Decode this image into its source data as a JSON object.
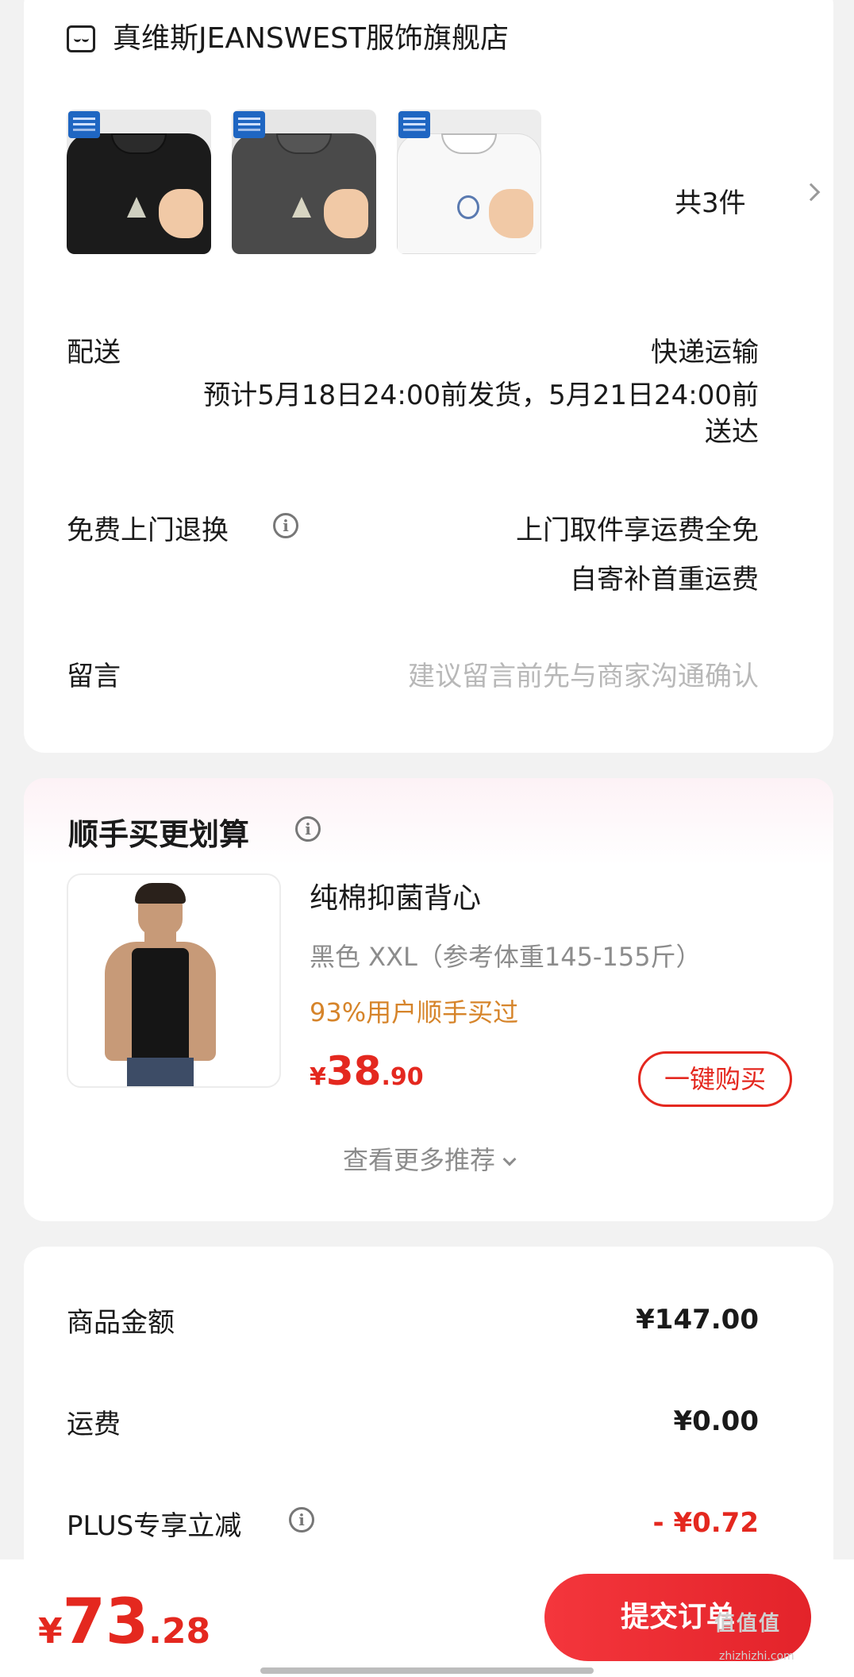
{
  "store": {
    "name": "真维斯JEANSWEST服饰旗舰店",
    "items": [
      {
        "name": "black-tee",
        "color": "#1b1b1b"
      },
      {
        "name": "gray-tee",
        "color": "#4a4a4a"
      },
      {
        "name": "white-tee",
        "color": "#f6f6f6"
      }
    ],
    "count_label": "共3件"
  },
  "delivery": {
    "label": "配送",
    "method": "快递运输",
    "estimate_line1": "预计5月18日24:00前发货，5月21日24:00前",
    "estimate_line2": "送达"
  },
  "returns": {
    "label": "免费上门退换",
    "line1": "上门取件享运费全免",
    "line2": "自寄补首重运费"
  },
  "message": {
    "label": "留言",
    "placeholder": "建议留言前先与商家沟通确认"
  },
  "upsell": {
    "title": "顺手买更划算",
    "product_name": "纯棉抑菌背心",
    "spec": "黑色   XXL（参考体重145-155斤）",
    "social": "93%用户顺手买过",
    "price_currency": "¥",
    "price_int": "38",
    "price_dec": ".90",
    "buy_label": "一键购买",
    "more_label": "查看更多推荐"
  },
  "summary": {
    "rows": [
      {
        "label": "商品金额",
        "value": "¥147.00"
      },
      {
        "label": "运费",
        "value": "¥0.00"
      },
      {
        "label": "PLUS专享立减",
        "value": "- ¥0.72"
      }
    ]
  },
  "footer": {
    "total_currency": "¥",
    "total_int": "73",
    "total_dec": ".28",
    "submit_label": "提交订单",
    "watermark": "值值值",
    "watermark_url": "zhizhizhi.com"
  },
  "colors": {
    "accent": "#e4281f",
    "social": "#d6842a",
    "muted": "#8c8c8c"
  }
}
